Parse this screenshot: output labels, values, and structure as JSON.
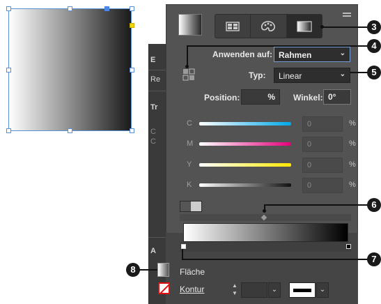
{
  "canvas": {
    "frame_gradient_colors": [
      "#ffffff",
      "#9a9a9a",
      "#1a1a1a"
    ],
    "handle_color": "#5b8fd8",
    "anchor_color": "#f2d600"
  },
  "back_panel": {
    "items": [
      "E",
      "Re",
      "Tr",
      "C",
      "C",
      "A"
    ]
  },
  "panel": {
    "tabs": [
      {
        "name": "swatches",
        "icon": "grid-swatch-icon"
      },
      {
        "name": "color",
        "icon": "palette-icon"
      },
      {
        "name": "gradient",
        "icon": "gradient-icon",
        "active": true
      }
    ],
    "apply_to": {
      "label": "Anwenden auf:",
      "value": "Rahmen"
    },
    "type": {
      "label": "Typ:",
      "value": "Linear"
    },
    "position": {
      "label": "Position:",
      "value": "",
      "unit": "%"
    },
    "angle": {
      "label": "Winkel:",
      "value": "0°"
    },
    "sliders": [
      {
        "letter": "C",
        "value": "0",
        "unit": "%"
      },
      {
        "letter": "M",
        "value": "0",
        "unit": "%"
      },
      {
        "letter": "Y",
        "value": "0",
        "unit": "%"
      },
      {
        "letter": "K",
        "value": "0",
        "unit": "%"
      }
    ],
    "gradient_stops": [
      {
        "color": "#ffffff",
        "location_pct": 0
      },
      {
        "color": "#000000",
        "location_pct": 100
      }
    ],
    "midpoint_pct": 50,
    "fill_label": "Fläche",
    "stroke_label": "Kontur"
  },
  "callouts": [
    "3",
    "4",
    "5",
    "6",
    "7",
    "8"
  ]
}
